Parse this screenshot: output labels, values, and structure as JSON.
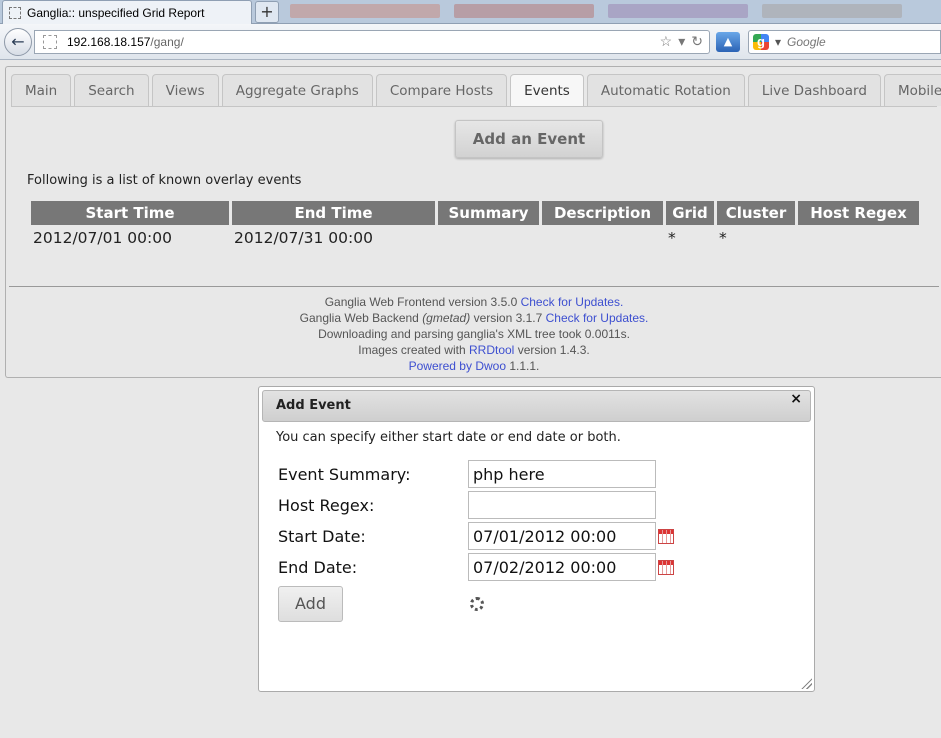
{
  "browser": {
    "tab_title": "Ganglia:: unspecified Grid Report",
    "new_tab_label": "+",
    "url_host": "192.168.18.157",
    "url_path": "/gang/",
    "search_placeholder": "Google"
  },
  "nav": {
    "tabs": [
      "Main",
      "Search",
      "Views",
      "Aggregate Graphs",
      "Compare Hosts",
      "Events",
      "Automatic Rotation",
      "Live Dashboard",
      "Mobile"
    ],
    "active_tab": "Events"
  },
  "events_page": {
    "add_button": "Add an Event",
    "intro": "Following is a list of known overlay events",
    "columns": [
      "Start Time",
      "End Time",
      "Summary",
      "Description",
      "Grid",
      "Cluster",
      "Host Regex"
    ],
    "rows": [
      [
        "2012/07/01 00:00",
        "2012/07/31 00:00",
        "",
        "",
        "*",
        "*",
        ""
      ]
    ]
  },
  "footer": {
    "frontend": "Ganglia Web Frontend version 3.5.0",
    "frontend_link": "Check for Updates.",
    "backend_pre": "Ganglia Web Backend",
    "backend_italic": "(gmetad)",
    "backend_post": "version 3.1.7",
    "backend_link": "Check for Updates.",
    "parse": "Downloading and parsing ganglia's XML tree took 0.0011s.",
    "images_pre": "Images created with",
    "images_link": "RRDtool",
    "images_post": "version 1.4.3.",
    "powered_link": "Powered by Dwoo",
    "powered_post": "1.1.1."
  },
  "dialog": {
    "title": "Add Event",
    "close": "×",
    "note": "You can specify either start date or end date or both.",
    "fields": {
      "summary_label": "Event Summary:",
      "summary_value": "php here",
      "host_label": "Host Regex:",
      "host_value": "",
      "start_label": "Start Date:",
      "start_value": "07/01/2012 00:00",
      "end_label": "End Date:",
      "end_value": "07/02/2012 00:00"
    },
    "submit": "Add"
  }
}
